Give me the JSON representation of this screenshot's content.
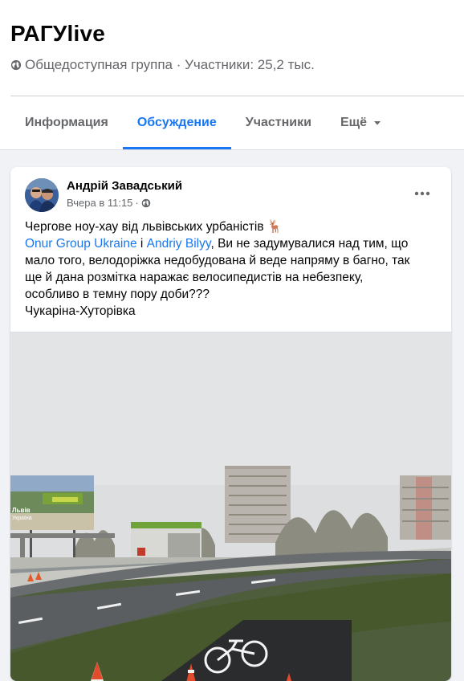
{
  "group": {
    "title": "РАГУlive",
    "meta": "Общедоступная группа · Участники: 25,2 тыс."
  },
  "tabs": [
    {
      "label": "Информация"
    },
    {
      "label": "Обсуждение"
    },
    {
      "label": "Участники"
    },
    {
      "label": "Ещё"
    }
  ],
  "post": {
    "author": "Андрій Завадський",
    "time": "Вчера в 11:15",
    "separator": "·",
    "line1": "Чергове ноу-хау від львівських урбаністів",
    "emoji": "🦌",
    "mention1": "Onur Group Ukraine",
    "conj": " і ",
    "mention2": "Andriy Bilyy",
    "line2_rest": ", Ви не задумувалися над тим, що",
    "line3": "мало того, велодоріжка недобудована й веде напряму в багно, так",
    "line4": "ще й дана розмітка наражає велосипедистів на небезпеку,",
    "line5": "особливо в темну пору доби???",
    "line6": "Чукаріна-Хуторівка",
    "billboard_text1": "Львів",
    "billboard_text2": "Україна"
  },
  "colors": {
    "accent": "#1877f2",
    "muted": "#65676b",
    "background": "#f0f2f5"
  },
  "icons": {
    "globe": "globe-icon",
    "more": "more-options-icon",
    "caret": "caret-down-icon",
    "public": "public-audience-icon"
  }
}
